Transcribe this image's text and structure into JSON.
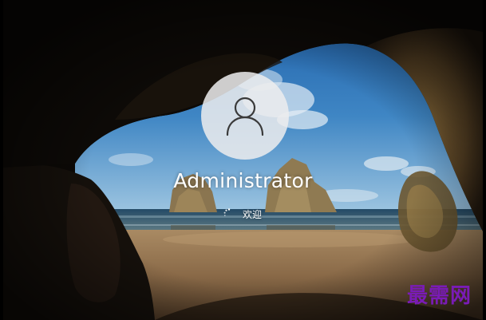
{
  "login": {
    "username": "Administrator",
    "status_text": "欢迎"
  },
  "icons": {
    "avatar": "user-icon",
    "loading": "loading-spinner-icon"
  },
  "watermark": {
    "text": "最需网",
    "color": "#7a1bb6"
  },
  "colors": {
    "text": "#ffffff",
    "avatar_bg": "#ececee",
    "avatar_icon": "#3a3a3a"
  }
}
